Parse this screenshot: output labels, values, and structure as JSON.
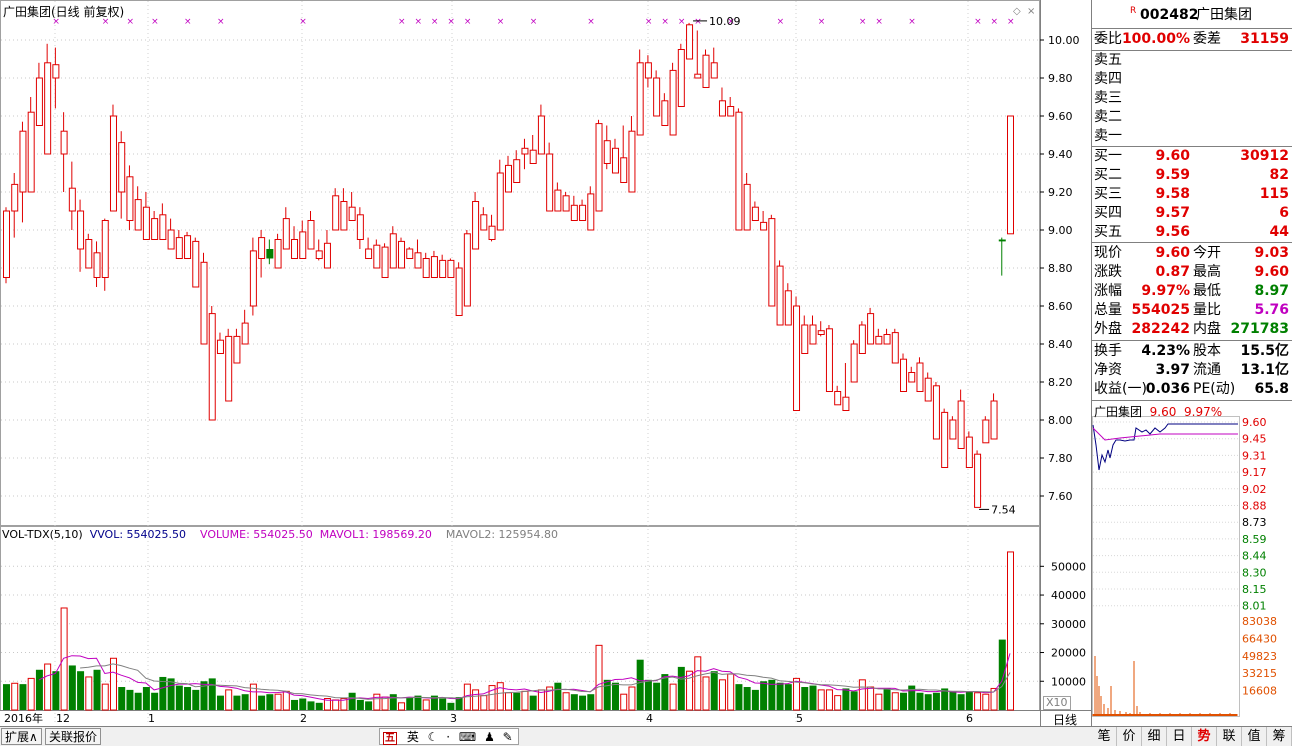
{
  "chart": {
    "title": "广田集团(日线 前复权)",
    "high_marker": "10.09",
    "low_marker": "7.54",
    "price_axis": [
      "10.00",
      "9.80",
      "9.60",
      "9.40",
      "9.20",
      "9.00",
      "8.80",
      "8.60",
      "8.40",
      "8.20",
      "8.00",
      "7.80",
      "7.60"
    ],
    "vol_axis": [
      "50000",
      "40000",
      "30000",
      "20000",
      "10000"
    ],
    "vol_unit": "X10",
    "x_labels": [
      "2016年",
      "12",
      "1",
      "2",
      "3",
      "4",
      "5",
      "6"
    ],
    "period_label": "日线",
    "indicator": {
      "name": "VOL-TDX(5,10)",
      "vvol": "VVOL: 554025.50",
      "volume": "VOLUME: 554025.50",
      "mavol1": "MAVOL1: 198569.20",
      "mavol2": "MAVOL2: 125954.80"
    },
    "colors": {
      "up": "#e00000",
      "down": "#008000",
      "ma1": "#c000c0",
      "ma2": "#c000c0",
      "grid": "#c0c0c0"
    }
  },
  "chart_data": {
    "type": "candlestick",
    "candles": [
      [
        8.75,
        9.1,
        8.72,
        9.12
      ],
      [
        9.1,
        9.24,
        8.96,
        9.3
      ],
      [
        9.2,
        9.52,
        9.04,
        9.57
      ],
      [
        9.2,
        9.62,
        9.45,
        9.7
      ],
      [
        9.55,
        9.8,
        9.55,
        9.88
      ],
      [
        9.4,
        9.88,
        9.47,
        9.98
      ],
      [
        9.8,
        9.87,
        9.64,
        9.96
      ],
      [
        9.4,
        9.52,
        9.2,
        9.62
      ],
      [
        9.1,
        9.22,
        9.0,
        9.36
      ],
      [
        8.9,
        9.1,
        8.78,
        9.16
      ],
      [
        8.8,
        8.95,
        8.88,
        8.98
      ],
      [
        8.75,
        8.88,
        8.7,
        8.94
      ],
      [
        8.75,
        9.05,
        8.68,
        9.06
      ],
      [
        9.1,
        9.6,
        9.3,
        9.66
      ],
      [
        9.2,
        9.46,
        9.06,
        9.52
      ],
      [
        9.05,
        9.28,
        9.0,
        9.34
      ],
      [
        9.0,
        9.16,
        9.02,
        9.23
      ],
      [
        8.95,
        9.12,
        9.02,
        9.2
      ],
      [
        8.95,
        9.06,
        9.0,
        9.1
      ],
      [
        8.95,
        9.08,
        9.0,
        9.14
      ],
      [
        8.9,
        9.0,
        8.92,
        9.06
      ],
      [
        8.85,
        8.96,
        8.9,
        9.0
      ],
      [
        8.85,
        8.97,
        8.94,
        8.99
      ],
      [
        8.7,
        8.94,
        8.8,
        8.96
      ],
      [
        8.4,
        8.83,
        8.52,
        8.88
      ],
      [
        8.0,
        8.56,
        8.3,
        8.6
      ],
      [
        8.35,
        8.42,
        8.4,
        8.46
      ],
      [
        8.1,
        8.44,
        8.4,
        8.48
      ],
      [
        8.3,
        8.44,
        8.41,
        8.48
      ],
      [
        8.4,
        8.51,
        8.42,
        8.58
      ],
      [
        8.6,
        8.89,
        8.55,
        8.96
      ],
      [
        8.85,
        8.96,
        8.75,
        9.0
      ],
      [
        8.9,
        8.85,
        8.82,
        8.95
      ],
      [
        8.8,
        8.95,
        8.86,
        8.98
      ],
      [
        8.9,
        9.06,
        8.9,
        9.12
      ],
      [
        8.85,
        8.95,
        8.85,
        9.02
      ],
      [
        8.85,
        8.99,
        8.93,
        9.05
      ],
      [
        8.9,
        9.05,
        8.98,
        9.1
      ],
      [
        8.85,
        8.89,
        8.84,
        8.95
      ],
      [
        8.8,
        8.93,
        8.86,
        9.0
      ],
      [
        9.0,
        9.18,
        9.0,
        9.22
      ],
      [
        9.0,
        9.15,
        9.12,
        9.22
      ],
      [
        9.05,
        9.12,
        9.06,
        9.2
      ],
      [
        8.95,
        9.08,
        8.9,
        9.12
      ],
      [
        8.85,
        8.9,
        8.88,
        8.96
      ],
      [
        8.8,
        8.92,
        8.84,
        8.95
      ],
      [
        8.75,
        8.91,
        8.88,
        8.93
      ],
      [
        8.8,
        8.98,
        8.95,
        9.02
      ],
      [
        8.8,
        8.94,
        8.84,
        8.96
      ],
      [
        8.85,
        8.9,
        8.87,
        8.91
      ],
      [
        8.8,
        8.88,
        8.84,
        8.95
      ],
      [
        8.75,
        8.85,
        8.76,
        8.88
      ],
      [
        8.75,
        8.86,
        8.79,
        8.89
      ],
      [
        8.75,
        8.84,
        8.78,
        8.87
      ],
      [
        8.75,
        8.84,
        8.8,
        8.85
      ],
      [
        8.55,
        8.8,
        8.57,
        8.83
      ],
      [
        8.6,
        8.98,
        8.6,
        9.0
      ],
      [
        8.9,
        9.15,
        9.0,
        9.2
      ],
      [
        9.0,
        9.08,
        9.0,
        9.12
      ],
      [
        8.95,
        9.02,
        8.94,
        9.08
      ],
      [
        9.0,
        9.3,
        9.18,
        9.37
      ],
      [
        9.2,
        9.34,
        9.22,
        9.39
      ],
      [
        9.25,
        9.37,
        9.27,
        9.42
      ],
      [
        9.4,
        9.43,
        9.32,
        9.48
      ],
      [
        9.35,
        9.42,
        9.35,
        9.5
      ],
      [
        9.4,
        9.6,
        9.45,
        9.66
      ],
      [
        9.1,
        9.4,
        9.15,
        9.46
      ],
      [
        9.1,
        9.21,
        9.12,
        9.25
      ],
      [
        9.1,
        9.18,
        9.12,
        9.2
      ],
      [
        9.05,
        9.13,
        9.12,
        9.18
      ],
      [
        9.05,
        9.13,
        9.1,
        9.16
      ],
      [
        9.0,
        9.19,
        9.12,
        9.23
      ],
      [
        9.1,
        9.56,
        9.18,
        9.58
      ],
      [
        9.35,
        9.47,
        9.32,
        9.55
      ],
      [
        9.3,
        9.43,
        9.32,
        9.48
      ],
      [
        9.25,
        9.38,
        9.26,
        9.55
      ],
      [
        9.2,
        9.52,
        9.35,
        9.6
      ],
      [
        9.5,
        9.88,
        9.55,
        9.95
      ],
      [
        9.8,
        9.88,
        9.75,
        9.92
      ],
      [
        9.6,
        9.8,
        9.68,
        9.84
      ],
      [
        9.55,
        9.68,
        9.64,
        9.72
      ],
      [
        9.5,
        9.84,
        9.68,
        9.88
      ],
      [
        9.65,
        9.95,
        9.84,
        9.98
      ],
      [
        9.9,
        10.08,
        9.92,
        10.09
      ],
      [
        9.8,
        9.82,
        9.81,
        10.05
      ],
      [
        9.75,
        9.92,
        9.85,
        9.95
      ],
      [
        9.8,
        9.88,
        9.82,
        9.96
      ],
      [
        9.6,
        9.68,
        9.62,
        9.75
      ],
      [
        9.6,
        9.65,
        9.6,
        9.7
      ],
      [
        9.0,
        9.62,
        9.1,
        9.64
      ],
      [
        9.0,
        9.24,
        9.11,
        9.3
      ],
      [
        9.05,
        9.12,
        9.08,
        9.15
      ],
      [
        9.0,
        9.04,
        9.02,
        9.1
      ],
      [
        8.6,
        9.06,
        8.7,
        9.08
      ],
      [
        8.5,
        8.81,
        8.55,
        8.84
      ],
      [
        8.5,
        8.68,
        8.56,
        8.72
      ],
      [
        8.05,
        8.6,
        8.4,
        8.65
      ],
      [
        8.35,
        8.5,
        8.45,
        8.55
      ],
      [
        8.4,
        8.5,
        8.46,
        8.55
      ],
      [
        8.45,
        8.47,
        8.44,
        8.52
      ],
      [
        8.15,
        8.48,
        8.2,
        8.5
      ],
      [
        8.08,
        8.15,
        8.1,
        8.18
      ],
      [
        8.05,
        8.12,
        8.1,
        8.3
      ],
      [
        8.2,
        8.4,
        8.3,
        8.42
      ],
      [
        8.35,
        8.5,
        8.35,
        8.52
      ],
      [
        8.4,
        8.56,
        8.44,
        8.59
      ],
      [
        8.4,
        8.44,
        8.42,
        8.48
      ],
      [
        8.4,
        8.45,
        8.42,
        8.48
      ],
      [
        8.3,
        8.46,
        8.3,
        8.48
      ],
      [
        8.15,
        8.32,
        8.23,
        8.35
      ],
      [
        8.2,
        8.25,
        8.21,
        8.28
      ],
      [
        8.15,
        8.3,
        8.22,
        8.33
      ],
      [
        8.1,
        8.22,
        8.18,
        8.25
      ],
      [
        7.9,
        8.18,
        8.04,
        8.2
      ],
      [
        7.75,
        8.04,
        7.9,
        8.06
      ],
      [
        7.9,
        8.0,
        7.95,
        8.02
      ],
      [
        7.85,
        8.1,
        7.91,
        8.16
      ],
      [
        7.75,
        7.91,
        7.82,
        7.94
      ],
      [
        7.54,
        7.82,
        7.76,
        7.84
      ],
      [
        7.88,
        8.0,
        7.95,
        8.02
      ],
      [
        7.9,
        8.1,
        8.05,
        8.14
      ],
      [
        8.95,
        8.94,
        8.76,
        8.96
      ],
      [
        8.98,
        9.6,
        9.03,
        9.6
      ]
    ],
    "volume": [
      [
        0,
        9000
      ],
      [
        1,
        9300
      ],
      [
        0,
        9000
      ],
      [
        1,
        11000
      ],
      [
        0,
        14000
      ],
      [
        1,
        16000
      ],
      [
        0,
        13500
      ],
      [
        1,
        35500
      ],
      [
        0,
        15500
      ],
      [
        0,
        13500
      ],
      [
        1,
        11500
      ],
      [
        0,
        14000
      ],
      [
        1,
        9000
      ],
      [
        1,
        18000
      ],
      [
        0,
        8000
      ],
      [
        0,
        7000
      ],
      [
        0,
        6000
      ],
      [
        0,
        8000
      ],
      [
        0,
        6000
      ],
      [
        0,
        11500
      ],
      [
        0,
        11000
      ],
      [
        0,
        8500
      ],
      [
        0,
        8000
      ],
      [
        0,
        7000
      ],
      [
        0,
        10000
      ],
      [
        0,
        11000
      ],
      [
        0,
        5000
      ],
      [
        1,
        7000
      ],
      [
        0,
        5000
      ],
      [
        0,
        5500
      ],
      [
        1,
        9000
      ],
      [
        0,
        5000
      ],
      [
        0,
        5500
      ],
      [
        1,
        5500
      ],
      [
        1,
        6500
      ],
      [
        0,
        3500
      ],
      [
        0,
        4000
      ],
      [
        0,
        3000
      ],
      [
        0,
        2500
      ],
      [
        1,
        4000
      ],
      [
        1,
        3500
      ],
      [
        1,
        4000
      ],
      [
        0,
        6000
      ],
      [
        0,
        3500
      ],
      [
        0,
        3000
      ],
      [
        1,
        5500
      ],
      [
        1,
        4500
      ],
      [
        0,
        5500
      ],
      [
        1,
        2500
      ],
      [
        0,
        4500
      ],
      [
        0,
        5000
      ],
      [
        1,
        3500
      ],
      [
        0,
        5000
      ],
      [
        0,
        4000
      ],
      [
        0,
        2500
      ],
      [
        0,
        4500
      ],
      [
        1,
        9000
      ],
      [
        1,
        7000
      ],
      [
        1,
        5000
      ],
      [
        1,
        8500
      ],
      [
        1,
        9500
      ],
      [
        1,
        6000
      ],
      [
        0,
        6000
      ],
      [
        1,
        6500
      ],
      [
        0,
        5000
      ],
      [
        1,
        7000
      ],
      [
        1,
        8000
      ],
      [
        0,
        9500
      ],
      [
        1,
        6000
      ],
      [
        0,
        5500
      ],
      [
        0,
        5000
      ],
      [
        0,
        5500
      ],
      [
        1,
        22500
      ],
      [
        0,
        10500
      ],
      [
        0,
        9500
      ],
      [
        1,
        5500
      ],
      [
        1,
        8000
      ],
      [
        0,
        17500
      ],
      [
        0,
        10500
      ],
      [
        0,
        9500
      ],
      [
        0,
        12500
      ],
      [
        1,
        9000
      ],
      [
        0,
        15000
      ],
      [
        1,
        13500
      ],
      [
        1,
        18500
      ],
      [
        1,
        11500
      ],
      [
        0,
        13500
      ],
      [
        1,
        10500
      ],
      [
        1,
        12500
      ],
      [
        0,
        9000
      ],
      [
        0,
        8000
      ],
      [
        0,
        7000
      ],
      [
        0,
        10000
      ],
      [
        0,
        10500
      ],
      [
        0,
        9500
      ],
      [
        0,
        9000
      ],
      [
        1,
        11000
      ],
      [
        0,
        8000
      ],
      [
        0,
        8500
      ],
      [
        1,
        7000
      ],
      [
        1,
        7000
      ],
      [
        1,
        5000
      ],
      [
        0,
        7500
      ],
      [
        0,
        6500
      ],
      [
        1,
        10500
      ],
      [
        1,
        8000
      ],
      [
        1,
        5500
      ],
      [
        0,
        7500
      ],
      [
        1,
        6000
      ],
      [
        0,
        6000
      ],
      [
        0,
        8500
      ],
      [
        0,
        6000
      ],
      [
        0,
        5500
      ],
      [
        0,
        6000
      ],
      [
        0,
        7500
      ],
      [
        0,
        6500
      ],
      [
        0,
        5500
      ],
      [
        0,
        6500
      ],
      [
        1,
        6000
      ],
      [
        1,
        5500
      ],
      [
        1,
        7500
      ],
      [
        0,
        24500
      ],
      [
        1,
        55000
      ]
    ],
    "first_date_label": "2016年"
  },
  "panel": {
    "badge": "R",
    "code": "002482",
    "name": "广田集团",
    "weibi_label": "委比",
    "weibi": "100.00%",
    "weicha_label": "委差",
    "weicha": "31159",
    "sells": [
      {
        "label": "卖五"
      },
      {
        "label": "卖四"
      },
      {
        "label": "卖三"
      },
      {
        "label": "卖二"
      },
      {
        "label": "卖一"
      }
    ],
    "buys": [
      {
        "label": "买一",
        "price": "9.60",
        "vol": "30912"
      },
      {
        "label": "买二",
        "price": "9.59",
        "vol": "82"
      },
      {
        "label": "买三",
        "price": "9.58",
        "vol": "115"
      },
      {
        "label": "买四",
        "price": "9.57",
        "vol": "6"
      },
      {
        "label": "买五",
        "price": "9.56",
        "vol": "44"
      }
    ],
    "stats": [
      {
        "l1": "现价",
        "v1": "9.60",
        "c1": "red",
        "l2": "今开",
        "v2": "9.03",
        "c2": "red"
      },
      {
        "l1": "涨跌",
        "v1": "0.87",
        "c1": "red",
        "l2": "最高",
        "v2": "9.60",
        "c2": "red"
      },
      {
        "l1": "涨幅",
        "v1": "9.97%",
        "c1": "red",
        "l2": "最低",
        "v2": "8.97",
        "c2": "green"
      },
      {
        "l1": "总量",
        "v1": "554025",
        "c1": "red",
        "l2": "量比",
        "v2": "5.76",
        "c2": "magenta"
      },
      {
        "l1": "外盘",
        "v1": "282242",
        "c1": "red",
        "l2": "内盘",
        "v2": "271783",
        "c2": "green"
      }
    ],
    "fin": [
      {
        "l1": "换手",
        "v1": "4.23%",
        "l2": "股本",
        "v2": "15.5亿"
      },
      {
        "l1": "净资",
        "v1": "3.97",
        "l2": "流通",
        "v2": "13.1亿"
      },
      {
        "l1": "收益(一)",
        "v1": "0.036",
        "l2": "PE(动)",
        "v2": "65.8"
      }
    ],
    "mini": {
      "name": "广田集团",
      "price": "9.60",
      "pct": "9.97%",
      "price_axis": [
        "9.60",
        "9.45",
        "9.31",
        "9.17",
        "9.02",
        "8.88",
        "8.73",
        "8.59",
        "8.44",
        "8.30",
        "8.15",
        "8.01"
      ],
      "vol_axis": [
        "83038",
        "66430",
        "49823",
        "33215",
        "16608"
      ]
    },
    "tabs": [
      "笔",
      "价",
      "细",
      "日",
      "势",
      "联",
      "值",
      "筹"
    ],
    "active_tab": "势"
  },
  "bottom": {
    "btn1": "扩展∧",
    "btn2": "关联报价",
    "tool_wu": "五",
    "tool_ying": "英"
  }
}
